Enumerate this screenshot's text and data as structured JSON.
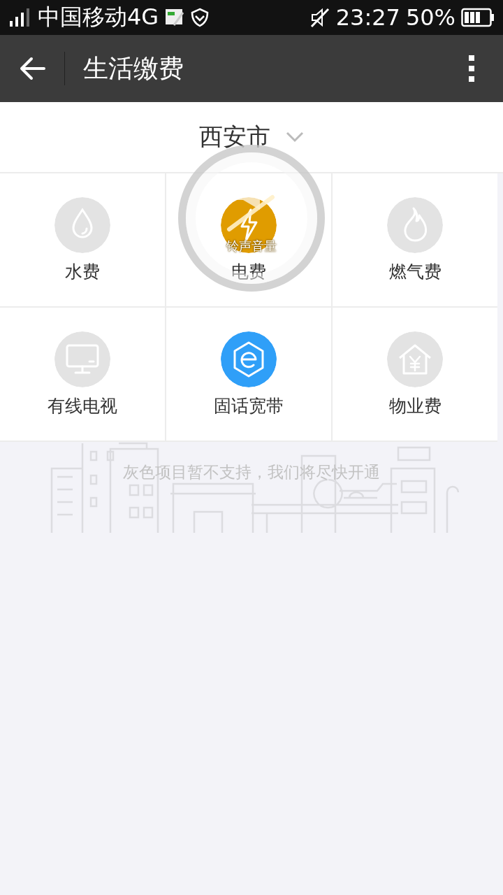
{
  "status_bar": {
    "carrier": "中国移动4G",
    "time": "23:27",
    "battery": "50%"
  },
  "toolbar": {
    "title": "生活缴费"
  },
  "city": {
    "name": "西安市"
  },
  "tiles": [
    {
      "kind": "water",
      "label": "水费",
      "color": "#e3e3e3"
    },
    {
      "kind": "power",
      "label": "电费",
      "color": "#e09c00"
    },
    {
      "kind": "gas",
      "label": "燃气费",
      "color": "#e3e3e3"
    },
    {
      "kind": "tv",
      "label": "有线电视",
      "color": "#e3e3e3"
    },
    {
      "kind": "broadband",
      "label": "固话宽带",
      "color": "#2f9ff8"
    },
    {
      "kind": "property",
      "label": "物业费",
      "color": "#e3e3e3"
    }
  ],
  "notice": "灰色项目暂不支持，我们将尽快开通",
  "volume_overlay": {
    "label": "铃声音量"
  }
}
